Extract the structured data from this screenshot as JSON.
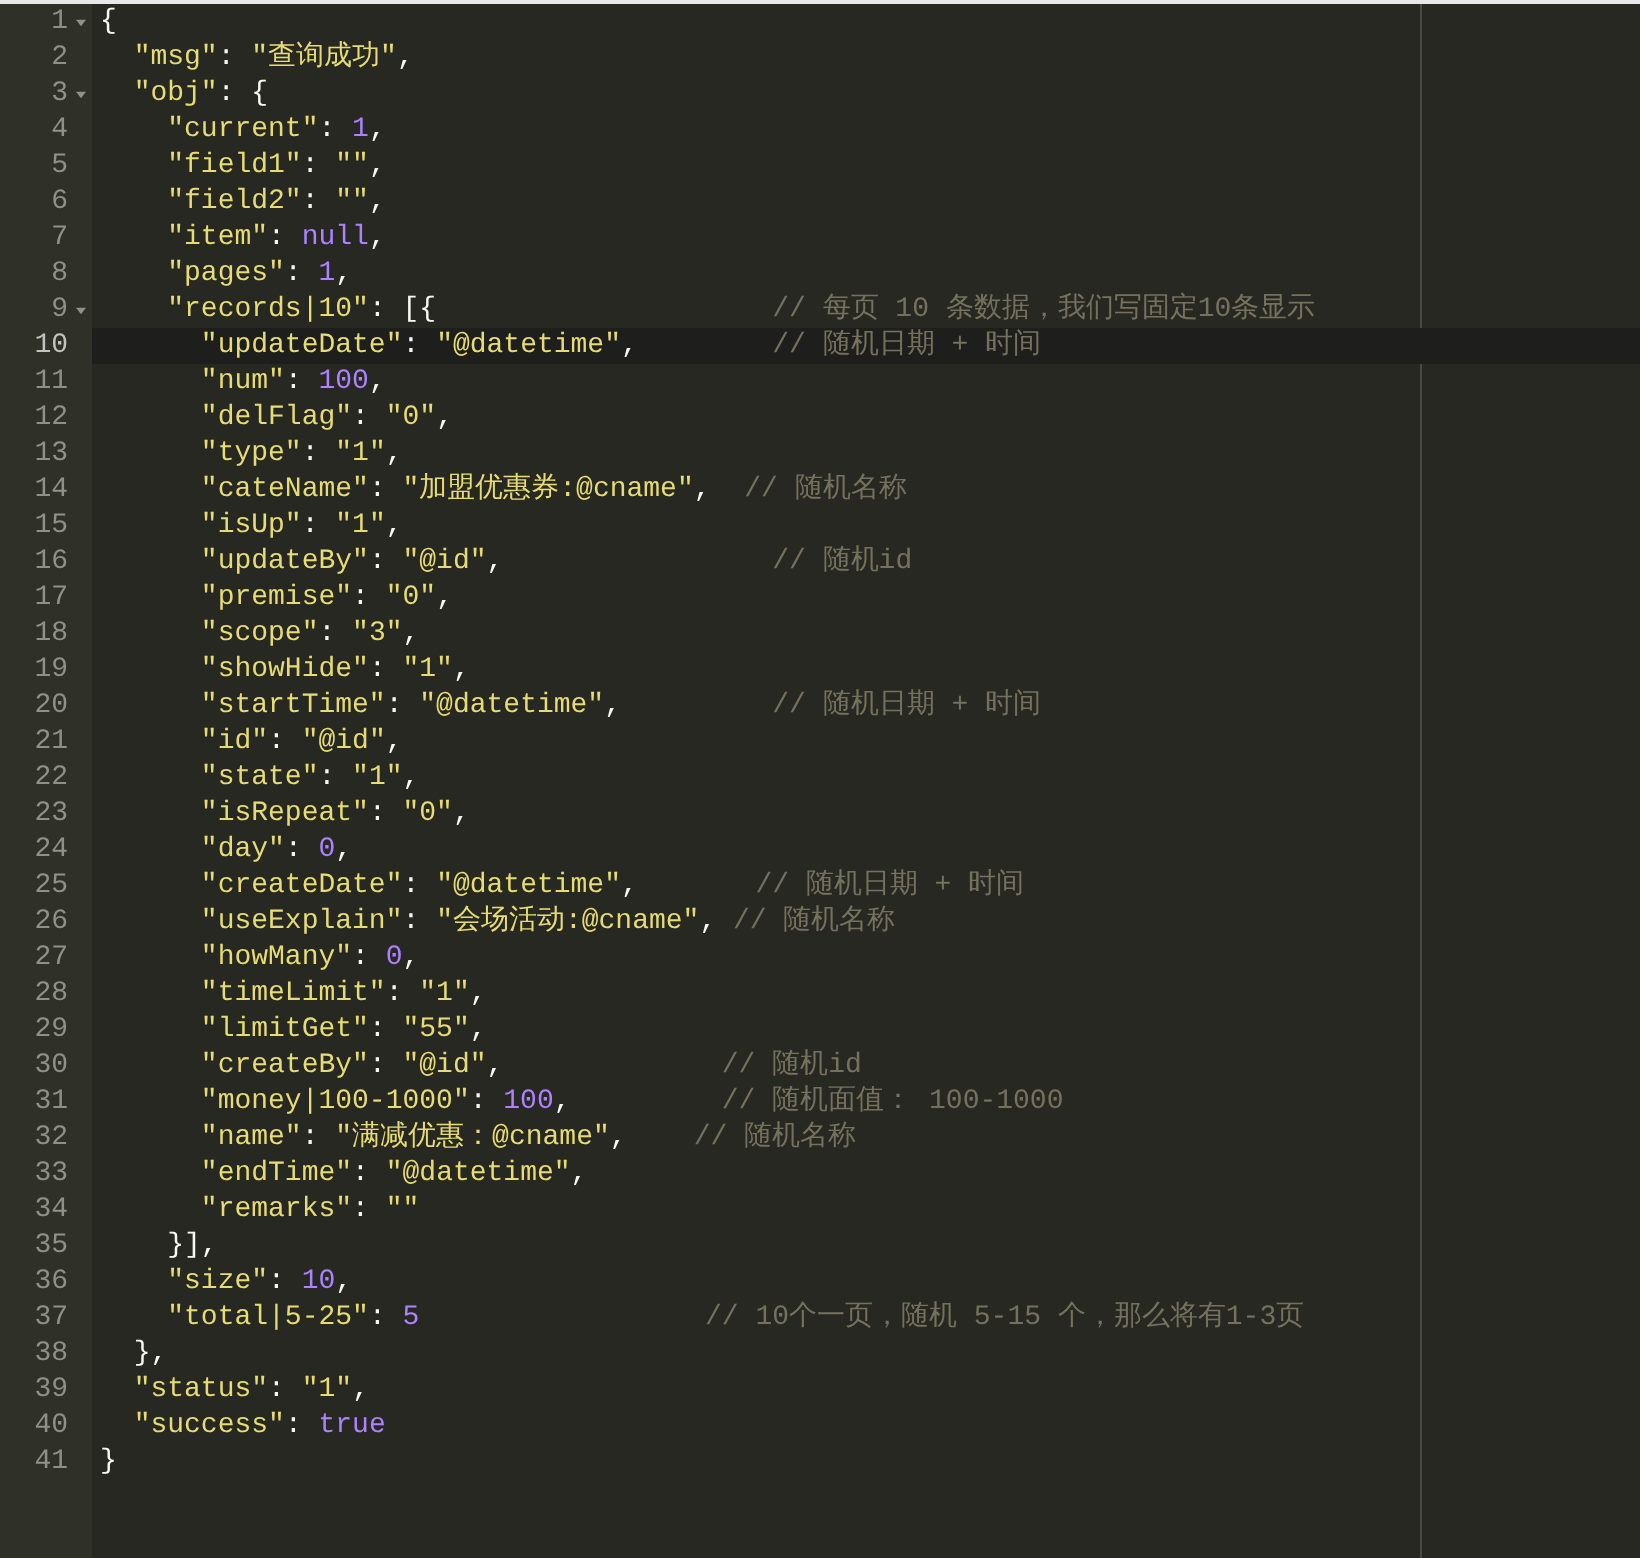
{
  "editor": {
    "lines": [
      {
        "number": "1",
        "fold": true,
        "current": false,
        "tokens": [
          {
            "kind": "punct",
            "text": "{"
          }
        ]
      },
      {
        "number": "2",
        "fold": false,
        "current": false,
        "tokens": [
          {
            "kind": "key",
            "text": "  \"msg\""
          },
          {
            "kind": "punct",
            "text": ": "
          },
          {
            "kind": "string",
            "text": "\"查询成功\""
          },
          {
            "kind": "punct",
            "text": ","
          }
        ]
      },
      {
        "number": "3",
        "fold": true,
        "current": false,
        "tokens": [
          {
            "kind": "key",
            "text": "  \"obj\""
          },
          {
            "kind": "punct",
            "text": ": {"
          }
        ]
      },
      {
        "number": "4",
        "fold": false,
        "current": false,
        "tokens": [
          {
            "kind": "key",
            "text": "    \"current\""
          },
          {
            "kind": "punct",
            "text": ": "
          },
          {
            "kind": "number",
            "text": "1"
          },
          {
            "kind": "punct",
            "text": ","
          }
        ]
      },
      {
        "number": "5",
        "fold": false,
        "current": false,
        "tokens": [
          {
            "kind": "key",
            "text": "    \"field1\""
          },
          {
            "kind": "punct",
            "text": ": "
          },
          {
            "kind": "string",
            "text": "\"\""
          },
          {
            "kind": "punct",
            "text": ","
          }
        ]
      },
      {
        "number": "6",
        "fold": false,
        "current": false,
        "tokens": [
          {
            "kind": "key",
            "text": "    \"field2\""
          },
          {
            "kind": "punct",
            "text": ": "
          },
          {
            "kind": "string",
            "text": "\"\""
          },
          {
            "kind": "punct",
            "text": ","
          }
        ]
      },
      {
        "number": "7",
        "fold": false,
        "current": false,
        "tokens": [
          {
            "kind": "key",
            "text": "    \"item\""
          },
          {
            "kind": "punct",
            "text": ": "
          },
          {
            "kind": "number",
            "text": "null"
          },
          {
            "kind": "punct",
            "text": ","
          }
        ]
      },
      {
        "number": "8",
        "fold": false,
        "current": false,
        "tokens": [
          {
            "kind": "key",
            "text": "    \"pages\""
          },
          {
            "kind": "punct",
            "text": ": "
          },
          {
            "kind": "number",
            "text": "1"
          },
          {
            "kind": "punct",
            "text": ","
          }
        ]
      },
      {
        "number": "9",
        "fold": true,
        "current": false,
        "tokens": [
          {
            "kind": "key",
            "text": "    \"records|10\""
          },
          {
            "kind": "punct",
            "text": ": [{"
          }
        ],
        "comment": "                    // 每页 10 条数据，我们写固定10条显示"
      },
      {
        "number": "10",
        "fold": false,
        "current": true,
        "tokens": [
          {
            "kind": "key",
            "text": "      \"updateDate\""
          },
          {
            "kind": "punct",
            "text": ": "
          },
          {
            "kind": "string",
            "text": "\"@datetime\""
          },
          {
            "kind": "punct",
            "text": ","
          }
        ],
        "comment": "        // 随机日期 + 时间"
      },
      {
        "number": "11",
        "fold": false,
        "current": false,
        "tokens": [
          {
            "kind": "key",
            "text": "      \"num\""
          },
          {
            "kind": "punct",
            "text": ": "
          },
          {
            "kind": "number",
            "text": "100"
          },
          {
            "kind": "punct",
            "text": ","
          }
        ]
      },
      {
        "number": "12",
        "fold": false,
        "current": false,
        "tokens": [
          {
            "kind": "key",
            "text": "      \"delFlag\""
          },
          {
            "kind": "punct",
            "text": ": "
          },
          {
            "kind": "string",
            "text": "\"0\""
          },
          {
            "kind": "punct",
            "text": ","
          }
        ]
      },
      {
        "number": "13",
        "fold": false,
        "current": false,
        "tokens": [
          {
            "kind": "key",
            "text": "      \"type\""
          },
          {
            "kind": "punct",
            "text": ": "
          },
          {
            "kind": "string",
            "text": "\"1\""
          },
          {
            "kind": "punct",
            "text": ","
          }
        ]
      },
      {
        "number": "14",
        "fold": false,
        "current": false,
        "tokens": [
          {
            "kind": "key",
            "text": "      \"cateName\""
          },
          {
            "kind": "punct",
            "text": ": "
          },
          {
            "kind": "string",
            "text": "\"加盟优惠券:@cname\""
          },
          {
            "kind": "punct",
            "text": ","
          }
        ],
        "comment": "  // 随机名称"
      },
      {
        "number": "15",
        "fold": false,
        "current": false,
        "tokens": [
          {
            "kind": "key",
            "text": "      \"isUp\""
          },
          {
            "kind": "punct",
            "text": ": "
          },
          {
            "kind": "string",
            "text": "\"1\""
          },
          {
            "kind": "punct",
            "text": ","
          }
        ]
      },
      {
        "number": "16",
        "fold": false,
        "current": false,
        "tokens": [
          {
            "kind": "key",
            "text": "      \"updateBy\""
          },
          {
            "kind": "punct",
            "text": ": "
          },
          {
            "kind": "string",
            "text": "\"@id\""
          },
          {
            "kind": "punct",
            "text": ","
          }
        ],
        "comment": "                // 随机id"
      },
      {
        "number": "17",
        "fold": false,
        "current": false,
        "tokens": [
          {
            "kind": "key",
            "text": "      \"premise\""
          },
          {
            "kind": "punct",
            "text": ": "
          },
          {
            "kind": "string",
            "text": "\"0\""
          },
          {
            "kind": "punct",
            "text": ","
          }
        ]
      },
      {
        "number": "18",
        "fold": false,
        "current": false,
        "tokens": [
          {
            "kind": "key",
            "text": "      \"scope\""
          },
          {
            "kind": "punct",
            "text": ": "
          },
          {
            "kind": "string",
            "text": "\"3\""
          },
          {
            "kind": "punct",
            "text": ","
          }
        ]
      },
      {
        "number": "19",
        "fold": false,
        "current": false,
        "tokens": [
          {
            "kind": "key",
            "text": "      \"showHide\""
          },
          {
            "kind": "punct",
            "text": ": "
          },
          {
            "kind": "string",
            "text": "\"1\""
          },
          {
            "kind": "punct",
            "text": ","
          }
        ]
      },
      {
        "number": "20",
        "fold": false,
        "current": false,
        "tokens": [
          {
            "kind": "key",
            "text": "      \"startTime\""
          },
          {
            "kind": "punct",
            "text": ": "
          },
          {
            "kind": "string",
            "text": "\"@datetime\""
          },
          {
            "kind": "punct",
            "text": ","
          }
        ],
        "comment": "         // 随机日期 + 时间"
      },
      {
        "number": "21",
        "fold": false,
        "current": false,
        "tokens": [
          {
            "kind": "key",
            "text": "      \"id\""
          },
          {
            "kind": "punct",
            "text": ": "
          },
          {
            "kind": "string",
            "text": "\"@id\""
          },
          {
            "kind": "punct",
            "text": ","
          }
        ]
      },
      {
        "number": "22",
        "fold": false,
        "current": false,
        "tokens": [
          {
            "kind": "key",
            "text": "      \"state\""
          },
          {
            "kind": "punct",
            "text": ": "
          },
          {
            "kind": "string",
            "text": "\"1\""
          },
          {
            "kind": "punct",
            "text": ","
          }
        ]
      },
      {
        "number": "23",
        "fold": false,
        "current": false,
        "tokens": [
          {
            "kind": "key",
            "text": "      \"isRepeat\""
          },
          {
            "kind": "punct",
            "text": ": "
          },
          {
            "kind": "string",
            "text": "\"0\""
          },
          {
            "kind": "punct",
            "text": ","
          }
        ]
      },
      {
        "number": "24",
        "fold": false,
        "current": false,
        "tokens": [
          {
            "kind": "key",
            "text": "      \"day\""
          },
          {
            "kind": "punct",
            "text": ": "
          },
          {
            "kind": "number",
            "text": "0"
          },
          {
            "kind": "punct",
            "text": ","
          }
        ]
      },
      {
        "number": "25",
        "fold": false,
        "current": false,
        "tokens": [
          {
            "kind": "key",
            "text": "      \"createDate\""
          },
          {
            "kind": "punct",
            "text": ": "
          },
          {
            "kind": "string",
            "text": "\"@datetime\""
          },
          {
            "kind": "punct",
            "text": ","
          }
        ],
        "comment": "       // 随机日期 + 时间"
      },
      {
        "number": "26",
        "fold": false,
        "current": false,
        "tokens": [
          {
            "kind": "key",
            "text": "      \"useExplain\""
          },
          {
            "kind": "punct",
            "text": ": "
          },
          {
            "kind": "string",
            "text": "\"会场活动:@cname\""
          },
          {
            "kind": "punct",
            "text": ","
          }
        ],
        "comment": " // 随机名称"
      },
      {
        "number": "27",
        "fold": false,
        "current": false,
        "tokens": [
          {
            "kind": "key",
            "text": "      \"howMany\""
          },
          {
            "kind": "punct",
            "text": ": "
          },
          {
            "kind": "number",
            "text": "0"
          },
          {
            "kind": "punct",
            "text": ","
          }
        ]
      },
      {
        "number": "28",
        "fold": false,
        "current": false,
        "tokens": [
          {
            "kind": "key",
            "text": "      \"timeLimit\""
          },
          {
            "kind": "punct",
            "text": ": "
          },
          {
            "kind": "string",
            "text": "\"1\""
          },
          {
            "kind": "punct",
            "text": ","
          }
        ]
      },
      {
        "number": "29",
        "fold": false,
        "current": false,
        "tokens": [
          {
            "kind": "key",
            "text": "      \"limitGet\""
          },
          {
            "kind": "punct",
            "text": ": "
          },
          {
            "kind": "string",
            "text": "\"55\""
          },
          {
            "kind": "punct",
            "text": ","
          }
        ]
      },
      {
        "number": "30",
        "fold": false,
        "current": false,
        "tokens": [
          {
            "kind": "key",
            "text": "      \"createBy\""
          },
          {
            "kind": "punct",
            "text": ": "
          },
          {
            "kind": "string",
            "text": "\"@id\""
          },
          {
            "kind": "punct",
            "text": ","
          }
        ],
        "comment": "             // 随机id"
      },
      {
        "number": "31",
        "fold": false,
        "current": false,
        "tokens": [
          {
            "kind": "key",
            "text": "      \"money|100-1000\""
          },
          {
            "kind": "punct",
            "text": ": "
          },
          {
            "kind": "number",
            "text": "100"
          },
          {
            "kind": "punct",
            "text": ","
          }
        ],
        "comment": "         // 随机面值： 100-1000"
      },
      {
        "number": "32",
        "fold": false,
        "current": false,
        "tokens": [
          {
            "kind": "key",
            "text": "      \"name\""
          },
          {
            "kind": "punct",
            "text": ": "
          },
          {
            "kind": "string",
            "text": "\"满减优惠：@cname\""
          },
          {
            "kind": "punct",
            "text": ","
          }
        ],
        "comment": "    // 随机名称"
      },
      {
        "number": "33",
        "fold": false,
        "current": false,
        "tokens": [
          {
            "kind": "key",
            "text": "      \"endTime\""
          },
          {
            "kind": "punct",
            "text": ": "
          },
          {
            "kind": "string",
            "text": "\"@datetime\""
          },
          {
            "kind": "punct",
            "text": ","
          }
        ]
      },
      {
        "number": "34",
        "fold": false,
        "current": false,
        "tokens": [
          {
            "kind": "key",
            "text": "      \"remarks\""
          },
          {
            "kind": "punct",
            "text": ": "
          },
          {
            "kind": "string",
            "text": "\"\""
          }
        ]
      },
      {
        "number": "35",
        "fold": false,
        "current": false,
        "tokens": [
          {
            "kind": "punct",
            "text": "    }],"
          }
        ]
      },
      {
        "number": "36",
        "fold": false,
        "current": false,
        "tokens": [
          {
            "kind": "key",
            "text": "    \"size\""
          },
          {
            "kind": "punct",
            "text": ": "
          },
          {
            "kind": "number",
            "text": "10"
          },
          {
            "kind": "punct",
            "text": ","
          }
        ]
      },
      {
        "number": "37",
        "fold": false,
        "current": false,
        "tokens": [
          {
            "kind": "key",
            "text": "    \"total|5-25\""
          },
          {
            "kind": "punct",
            "text": ": "
          },
          {
            "kind": "number",
            "text": "5"
          }
        ],
        "comment": "                 // 10个一页，随机 5-15 个，那么将有1-3页"
      },
      {
        "number": "38",
        "fold": false,
        "current": false,
        "tokens": [
          {
            "kind": "punct",
            "text": "  },"
          }
        ]
      },
      {
        "number": "39",
        "fold": false,
        "current": false,
        "tokens": [
          {
            "kind": "key",
            "text": "  \"status\""
          },
          {
            "kind": "punct",
            "text": ": "
          },
          {
            "kind": "string",
            "text": "\"1\""
          },
          {
            "kind": "punct",
            "text": ","
          }
        ]
      },
      {
        "number": "40",
        "fold": false,
        "current": false,
        "tokens": [
          {
            "kind": "key",
            "text": "  \"success\""
          },
          {
            "kind": "punct",
            "text": ": "
          },
          {
            "kind": "number",
            "text": "true"
          }
        ]
      },
      {
        "number": "41",
        "fold": false,
        "current": false,
        "tokens": [
          {
            "kind": "punct",
            "text": "}"
          }
        ]
      }
    ]
  }
}
